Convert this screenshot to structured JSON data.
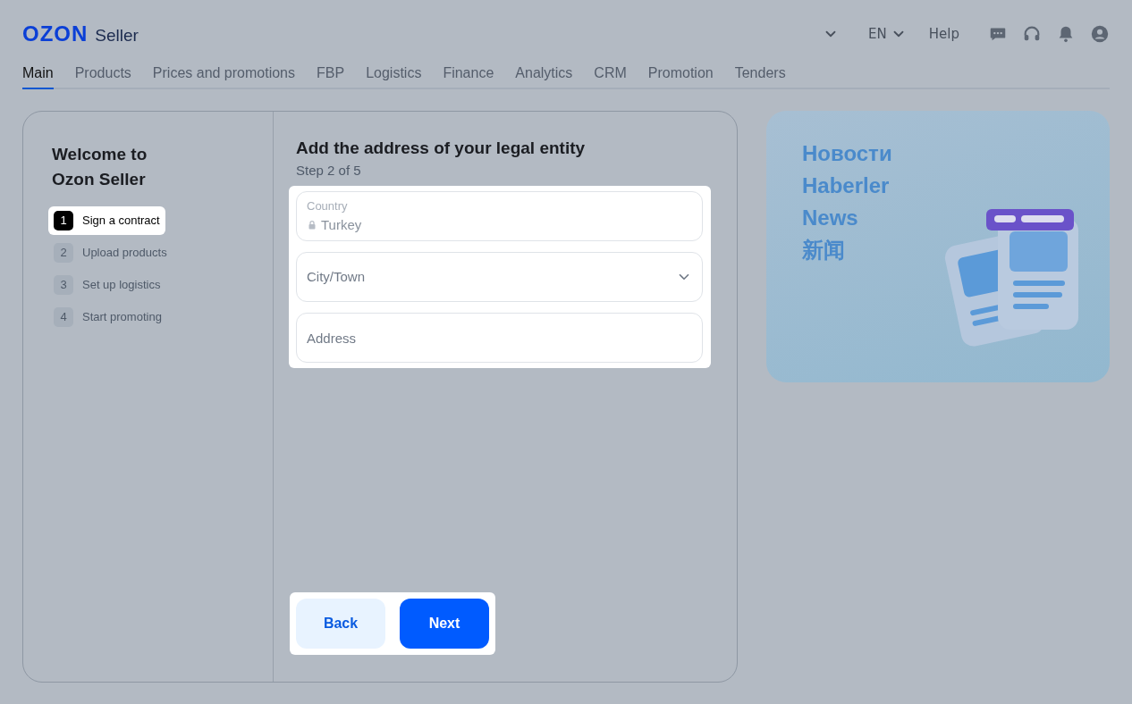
{
  "header": {
    "logo": "OZON",
    "logo_suffix": "Seller",
    "language": "EN",
    "help": "Help"
  },
  "nav": [
    {
      "label": "Main",
      "selected": true
    },
    {
      "label": "Products",
      "selected": false
    },
    {
      "label": "Prices and promotions",
      "selected": false
    },
    {
      "label": "FBP",
      "selected": false
    },
    {
      "label": "Logistics",
      "selected": false
    },
    {
      "label": "Finance",
      "selected": false
    },
    {
      "label": "Analytics",
      "selected": false
    },
    {
      "label": "CRM",
      "selected": false
    },
    {
      "label": "Promotion",
      "selected": false
    },
    {
      "label": "Tenders",
      "selected": false
    }
  ],
  "sidebar": {
    "title": "Welcome to Ozon Seller",
    "steps": [
      {
        "number": "1",
        "label": "Sign a contract",
        "selected": true
      },
      {
        "number": "2",
        "label": "Upload products",
        "selected": false
      },
      {
        "number": "3",
        "label": "Set up logistics",
        "selected": false
      },
      {
        "number": "4",
        "label": "Start promoting",
        "selected": false
      }
    ]
  },
  "form": {
    "title": "Add the address of your legal entity",
    "step": "Step 2 of 5",
    "fields": [
      {
        "kind": "locked",
        "label": "Country",
        "value": "Turkey"
      },
      {
        "kind": "select",
        "placeholder": "City/Town"
      },
      {
        "kind": "text",
        "placeholder": "Address"
      }
    ],
    "buttons": [
      {
        "label": "Back",
        "kind": "secondary"
      },
      {
        "label": "Next",
        "kind": "primary"
      }
    ]
  },
  "banner": {
    "lines": [
      "Новости",
      "Haberler",
      "News",
      "新闻"
    ]
  }
}
